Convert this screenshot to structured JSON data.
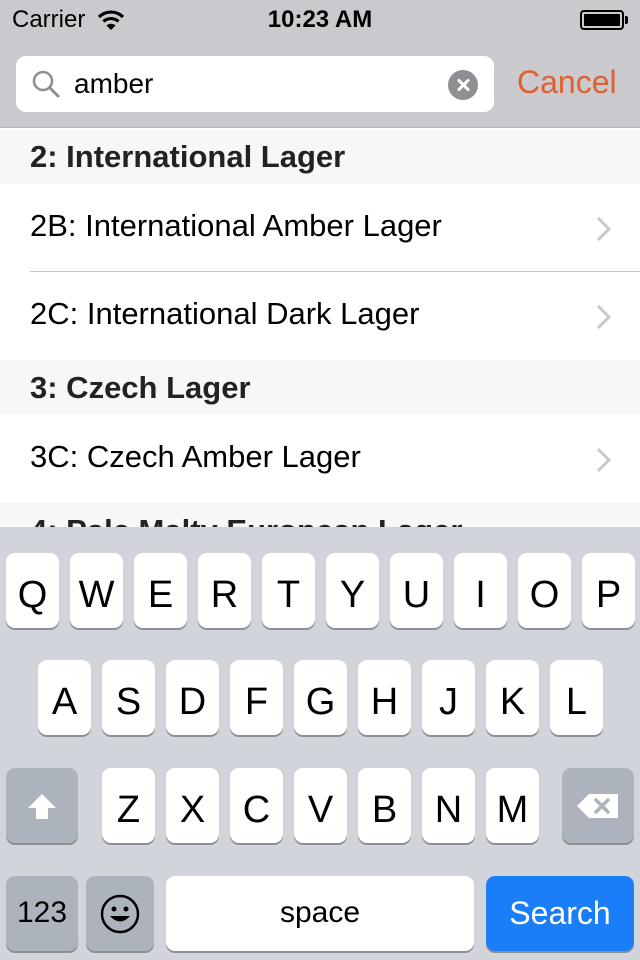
{
  "status_bar": {
    "carrier": "Carrier",
    "time": "10:23 AM"
  },
  "search": {
    "query": "amber",
    "cancel_label": "Cancel"
  },
  "sections": [
    {
      "title": "2: International Lager",
      "rows": [
        "2B: International Amber Lager",
        "2C: International Dark Lager"
      ]
    },
    {
      "title": "3: Czech Lager",
      "rows": [
        "3C: Czech Amber Lager"
      ]
    },
    {
      "title": "4: Pale Malty European Lager",
      "rows": []
    }
  ],
  "keyboard": {
    "row1": [
      "Q",
      "W",
      "E",
      "R",
      "T",
      "Y",
      "U",
      "I",
      "O",
      "P"
    ],
    "row2": [
      "A",
      "S",
      "D",
      "F",
      "G",
      "H",
      "J",
      "K",
      "L"
    ],
    "row3": [
      "Z",
      "X",
      "C",
      "V",
      "B",
      "N",
      "M"
    ],
    "numbers_label": "123",
    "space_label": "space",
    "return_label": "Search",
    "icons": {
      "shift": "shift-icon",
      "delete": "delete-icon",
      "emoji": "emoji-icon"
    }
  },
  "colors": {
    "accent": "#e0612e",
    "search_key": "#1a7ef8"
  }
}
